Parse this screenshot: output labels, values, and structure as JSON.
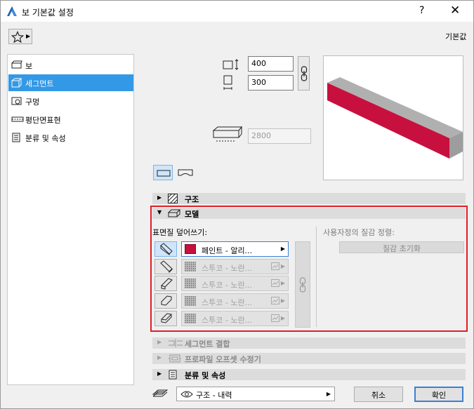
{
  "window": {
    "title": "보 기본값 설정",
    "help_label": "?",
    "close_label": "✕",
    "app_icon": "archicad-icon"
  },
  "toolbar": {
    "favorites_icon": "star-icon",
    "default_label": "기본값"
  },
  "nav": {
    "items": [
      {
        "label": "보",
        "icon": "beam-icon",
        "selected": false
      },
      {
        "label": "세그먼트",
        "icon": "segment-icon",
        "selected": true
      },
      {
        "label": "구멍",
        "icon": "hole-icon",
        "selected": false
      },
      {
        "label": "평단면표현",
        "icon": "floor-plan-icon",
        "selected": false
      },
      {
        "label": "분류 및 속성",
        "icon": "document-icon",
        "selected": false
      }
    ]
  },
  "dimensions": {
    "height_value": "400",
    "width_value": "300",
    "length_value": "2800"
  },
  "sections": {
    "structure": {
      "label": "구조",
      "expanded": false
    },
    "model": {
      "label": "모델",
      "expanded": true
    },
    "segment_join": {
      "label": "세그먼트 결합",
      "expanded": false,
      "disabled": true
    },
    "profile_offset": {
      "label": "프로파일 오프셋 수정기",
      "expanded": false,
      "disabled": true
    },
    "classification": {
      "label": "분류 및 속성",
      "expanded": false
    }
  },
  "model": {
    "surface_override_label": "표면질 덮어쓰기:",
    "custom_texture_label": "사용자정의 질감 정렬:",
    "reset_texture_label": "질감 초기화",
    "materials": [
      {
        "label": "페인트 - 알리...",
        "active": true,
        "swatch_color": "#c8103e"
      },
      {
        "label": "스투코 - 노란...",
        "active": false
      },
      {
        "label": "스투코 - 노란...",
        "active": false
      },
      {
        "label": "스투코 - 노란...",
        "active": false
      },
      {
        "label": "스투코 - 노란...",
        "active": false
      }
    ]
  },
  "footer": {
    "layer_label": "구조 - 내력",
    "cancel_label": "취소",
    "ok_label": "확인"
  },
  "colors": {
    "accent": "#3399e6",
    "highlight_frame": "#e01e26",
    "beam_side": "#c8103e",
    "beam_face": "#9d9d9d"
  }
}
